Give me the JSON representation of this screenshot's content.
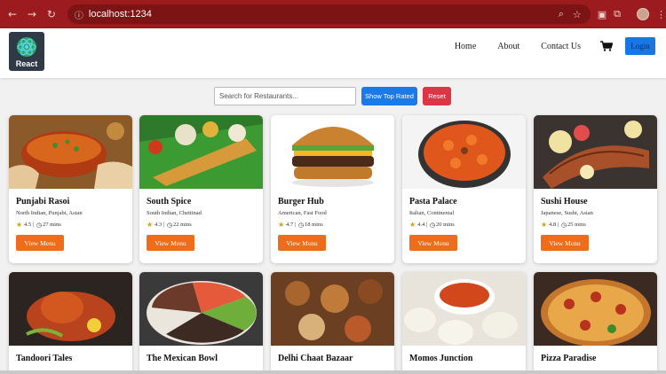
{
  "browser": {
    "url": "localhost:1234"
  },
  "header": {
    "logo_text": "React",
    "nav": [
      "Home",
      "About",
      "Contact Us"
    ],
    "login_label": "Login"
  },
  "search": {
    "placeholder": "Search for Restaurants...",
    "top_rated_label": "Show Top Rated",
    "reset_label": "Reset"
  },
  "restaurants": [
    {
      "name": "Punjabi Rasoi",
      "cuisine": "North Indian, Punjabi, Asian",
      "rating": "4.5",
      "time": "27 mins",
      "button": "View Menu"
    },
    {
      "name": "South Spice",
      "cuisine": "South Indian, Chettinad",
      "rating": "4.3",
      "time": "22 mins",
      "button": "View Menu"
    },
    {
      "name": "Burger Hub",
      "cuisine": "American, Fast Food",
      "rating": "4.7",
      "time": "18 mins",
      "button": "View Menu"
    },
    {
      "name": "Pasta Palace",
      "cuisine": "Italian, Continental",
      "rating": "4.4",
      "time": "20 mins",
      "button": "View Menu"
    },
    {
      "name": "Sushi House",
      "cuisine": "Japanese, Sushi, Asian",
      "rating": "4.8",
      "time": "25 mins",
      "button": "View Menu"
    },
    {
      "name": "Tandoori Tales"
    },
    {
      "name": "The Mexican Bowl"
    },
    {
      "name": "Delhi Chaat Bazaar"
    },
    {
      "name": "Momos Junction"
    },
    {
      "name": "Pizza Paradise"
    }
  ],
  "colors": {
    "chrome": "#9b1b1e",
    "primary": "#1a7ae8",
    "danger": "#dc3545",
    "accent": "#ef6c1a"
  }
}
